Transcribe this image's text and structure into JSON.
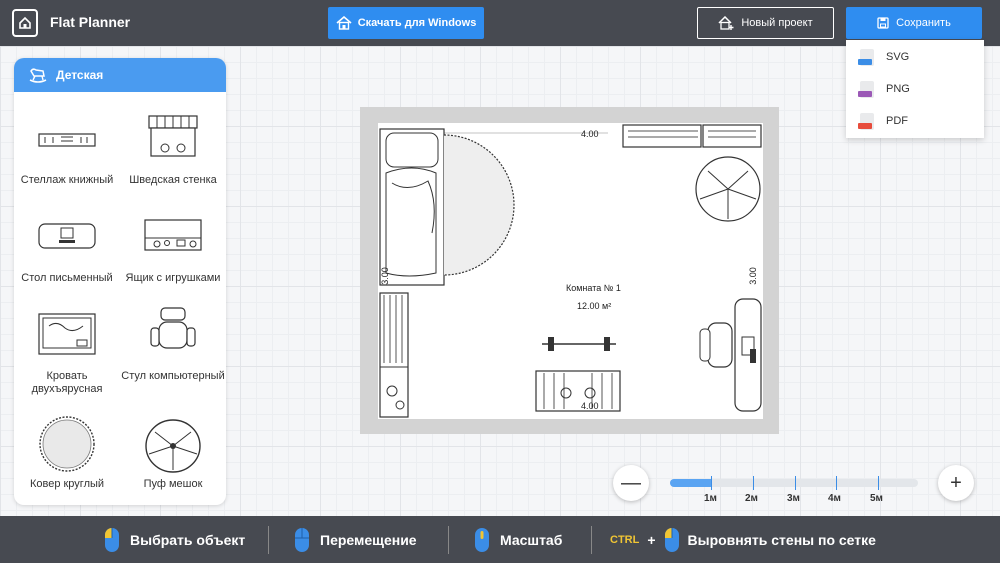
{
  "app": {
    "title": "Flat Planner"
  },
  "toolbar": {
    "download_label": "Скачать для Windows",
    "new_project_label": "Новый проект",
    "save_label": "Сохранить"
  },
  "save_menu": {
    "items": [
      "SVG",
      "PNG",
      "PDF"
    ]
  },
  "colors": {
    "accent": "#2f8df0",
    "bar": "#474a51",
    "panel_head": "#4a9bf0",
    "ctrl": "#f0c534"
  },
  "panel": {
    "title": "Детская",
    "items": [
      "Стеллаж книжный",
      "Шведская стенка",
      "Стол письменный",
      "Ящик с игрушками",
      "Кровать двухъярусная",
      "Стул компьютерный",
      "Ковер круглый",
      "Пуф мешок"
    ]
  },
  "plan": {
    "room_name": "Комната №  1",
    "area": "12.00 м²",
    "dim_top": "4.00",
    "dim_bottom": "4.00",
    "dim_left": "3.00",
    "dim_right": "3.00"
  },
  "zoom": {
    "minus": "—",
    "plus": "+",
    "scale_labels": [
      "1м",
      "2м",
      "3м",
      "4м",
      "5м"
    ],
    "level": 0.17
  },
  "hints": {
    "select": "Выбрать объект",
    "move": "Перемещение",
    "scale": "Масштаб",
    "ctrl": "CTRL",
    "plus": "+",
    "align": "Выровнять стены по сетке"
  }
}
